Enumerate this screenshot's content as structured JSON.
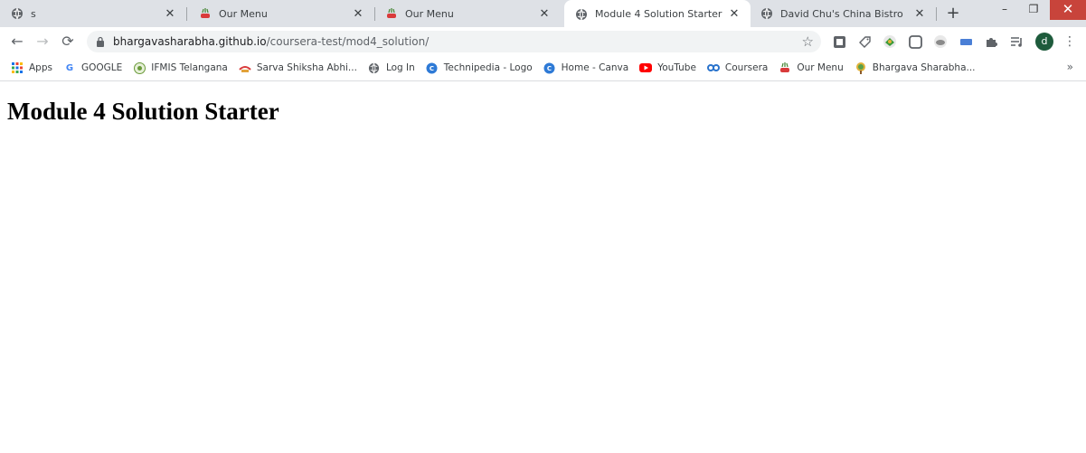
{
  "tabs": [
    {
      "title": "s",
      "icon": "globe-icon"
    },
    {
      "title": "Our Menu",
      "icon": "menu-bowl-icon"
    },
    {
      "title": "Our Menu",
      "icon": "menu-bowl-icon"
    },
    {
      "title": "Module 4 Solution Starter",
      "icon": "globe-icon",
      "active": true
    },
    {
      "title": "David Chu's China Bistro",
      "icon": "globe-icon"
    }
  ],
  "address_bar": {
    "host": "bhargavasharabha.github.io",
    "path": "/coursera-test/mod4_solution/"
  },
  "profile": {
    "initial": "d"
  },
  "bookmarks": [
    {
      "label": "Apps",
      "icon": "apps-grid-icon"
    },
    {
      "label": "GOOGLE",
      "icon": "google-icon"
    },
    {
      "label": "IFMIS Telangana",
      "icon": "ifmis-icon"
    },
    {
      "label": "Sarva Shiksha Abhi...",
      "icon": "ssa-icon"
    },
    {
      "label": "Log In",
      "icon": "globe-icon"
    },
    {
      "label": "Technipedia - Logo",
      "icon": "canva-icon"
    },
    {
      "label": "Home - Canva",
      "icon": "canva-icon"
    },
    {
      "label": "YouTube",
      "icon": "youtube-icon"
    },
    {
      "label": "Coursera",
      "icon": "coursera-icon"
    },
    {
      "label": "Our Menu",
      "icon": "menu-bowl-icon"
    },
    {
      "label": "Bhargava Sharabha...",
      "icon": "tree-icon"
    }
  ],
  "page": {
    "heading": "Module 4 Solution Starter"
  },
  "colors": {
    "tabbar_bg": "#dee1e6",
    "close_window_bg": "#c8443b",
    "avatar_bg": "#1e5b3c"
  }
}
